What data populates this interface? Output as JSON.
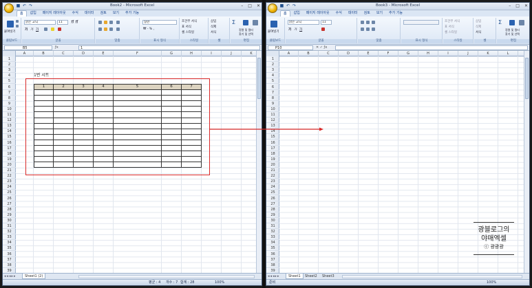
{
  "left": {
    "title": "Book2 - Microsoft Excel",
    "tabs": [
      "홈",
      "삽입",
      "페이지 레이아웃",
      "수식",
      "데이터",
      "검토",
      "보기",
      "추가 기능"
    ],
    "active_tab": "홈",
    "ribbon": {
      "paste": "붙여넣기",
      "font_name": "맑은 고딕",
      "font_size": "11",
      "number_format": "일반",
      "cond_format": "조건부 서식",
      "table_format": "표 서식",
      "cell_style": "셀 스타일",
      "insert": "삽입",
      "delete": "삭제",
      "format": "서식",
      "sort_filter": "정렬 및 필터",
      "find_select": "찾기 및 선택",
      "groups": [
        "클립보드",
        "글꼴",
        "맞춤",
        "표시 형식",
        "스타일",
        "셀",
        "편집"
      ]
    },
    "namebox": "B5",
    "formula": "1",
    "columns": [
      "A",
      "B",
      "C",
      "D",
      "E",
      "F",
      "G",
      "H",
      "I",
      "J",
      "K"
    ],
    "rows": [
      "1",
      "2",
      "3",
      "4",
      "5",
      "6",
      "7",
      "8",
      "9",
      "10",
      "11",
      "12",
      "13",
      "14",
      "15",
      "16",
      "17",
      "18",
      "19",
      "20",
      "21",
      "22",
      "23",
      "24",
      "25",
      "26",
      "27",
      "28",
      "29",
      "30",
      "31",
      "32",
      "33",
      "34",
      "35",
      "36",
      "37",
      "38",
      "39",
      "40"
    ],
    "sheet_label": "1번 시트",
    "table_headers": [
      "1",
      "2",
      "3",
      "4",
      "5",
      "6",
      "7"
    ],
    "sheet_tab": "Sheet1 (2)",
    "status": {
      "avg": "평균 : 4",
      "count": "개수 : 7",
      "sum": "합계 : 28",
      "zoom": "100%"
    }
  },
  "right": {
    "title": "Book3 - Microsoft Excel",
    "tabs": [
      "홈",
      "삽입",
      "페이지 레이아웃",
      "수식",
      "데이터",
      "검토",
      "보기",
      "추가 기능"
    ],
    "active_tab": "홈",
    "ribbon": {
      "paste": "붙여넣기",
      "font_name": "맑은 고딕",
      "font_size": "11",
      "cond_format": "조건부 서식",
      "table_format": "표 서식",
      "cell_style": "셀 스타일",
      "insert": "삽입",
      "delete": "삭제",
      "format": "서식",
      "sort_filter": "정렬 및 필터",
      "find_select": "찾기 및 선택",
      "groups": [
        "클립보드",
        "글꼴",
        "맞춤",
        "표시 형식",
        "스타일",
        "셀",
        "편집"
      ]
    },
    "namebox": "P10",
    "columns": [
      "A",
      "B",
      "C",
      "D",
      "E",
      "F",
      "G",
      "H",
      "I",
      "J",
      "K",
      "L",
      "M"
    ],
    "rows": [
      "1",
      "2",
      "3",
      "4",
      "5",
      "6",
      "7",
      "8",
      "9",
      "10",
      "11",
      "12",
      "13",
      "14",
      "15",
      "16",
      "17",
      "18",
      "19",
      "20",
      "21",
      "22",
      "23",
      "24",
      "25",
      "26",
      "27",
      "28",
      "29",
      "30",
      "31",
      "32",
      "33",
      "34",
      "35",
      "36",
      "37",
      "38",
      "39",
      "40"
    ],
    "sheet_tabs": [
      "Sheet1",
      "Sheet2",
      "Sheet3"
    ],
    "status": {
      "ready": "준비",
      "zoom": "100%"
    }
  },
  "watermark": {
    "line1": "광블로그의",
    "line2": "야매엑셀",
    "line3": "ⓒ 광광광"
  },
  "colors": {
    "highlight": "#d82828",
    "header_fill": "#dcd3c0",
    "office_blue": "#15428b"
  }
}
